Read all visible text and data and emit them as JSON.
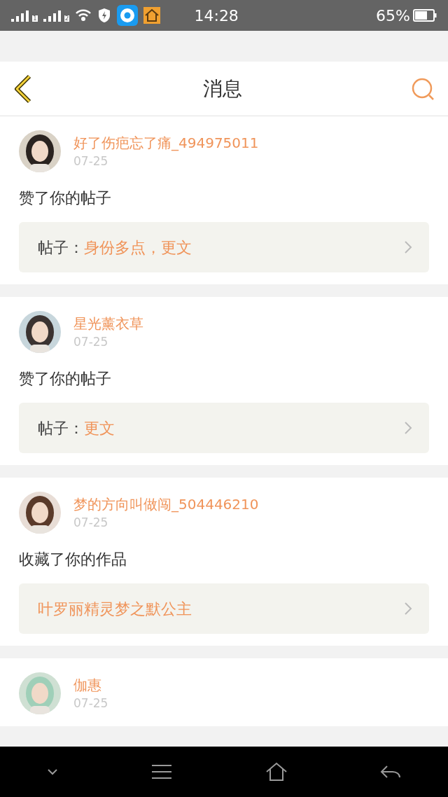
{
  "status_bar": {
    "sims": [
      "1",
      "2"
    ],
    "time": "14:28",
    "battery": "65%"
  },
  "header": {
    "title": "消息"
  },
  "messages": [
    {
      "user": "好了伤疤忘了痛_494975011",
      "date": "07-25",
      "action": "赞了你的帖子",
      "link": {
        "label": "帖子：",
        "title": "身份多点，更文"
      }
    },
    {
      "user": "星光薰衣草",
      "date": "07-25",
      "action": "赞了你的帖子",
      "link": {
        "label": "帖子：",
        "title": "更文"
      }
    },
    {
      "user": "梦的方向叫做闯_504446210",
      "date": "07-25",
      "action": "收藏了你的作品",
      "link": {
        "title": "叶罗丽精灵梦之默公主"
      }
    },
    {
      "user": "伽惠",
      "date": "07-25"
    }
  ]
}
